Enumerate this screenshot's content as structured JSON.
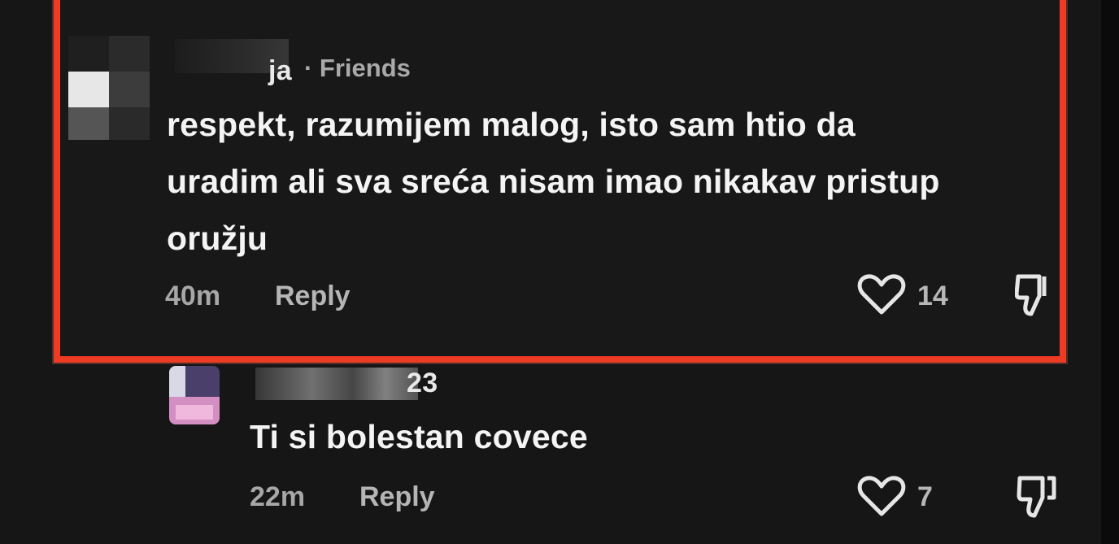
{
  "comments": [
    {
      "username_visible": "ja",
      "tag": "· Friends",
      "lines": [
        "respekt, razumijem malog, isto sam htio da",
        "uradim ali sva sreća nisam imao nikakav pristup",
        "oružju"
      ],
      "time": "40m",
      "reply_label": "Reply",
      "likes": "14",
      "highlight_color": "#ee3b24"
    },
    {
      "username_visible": "23",
      "text": "Ti si bolestan covece",
      "time": "22m",
      "reply_label": "Reply",
      "likes": "7"
    }
  ],
  "icons": {
    "like": "heart-outline-icon",
    "dislike": "thumbs-down-outline-icon"
  }
}
